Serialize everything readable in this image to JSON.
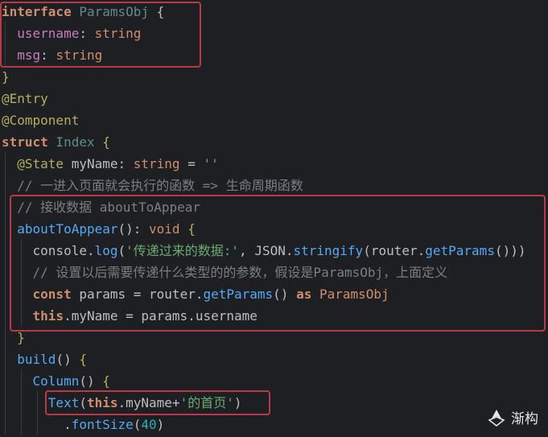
{
  "code": {
    "lines": [
      [
        {
          "t": "interface",
          "c": "kw"
        },
        {
          "t": " ParamsObj ",
          "c": "cls"
        },
        {
          "t": "{",
          "c": "plain"
        }
      ],
      [
        {
          "t": "  username",
          "c": "fld"
        },
        {
          "t": ": ",
          "c": "plain"
        },
        {
          "t": "string",
          "c": "type"
        }
      ],
      [
        {
          "t": "  msg",
          "c": "fld"
        },
        {
          "t": ": ",
          "c": "plain"
        },
        {
          "t": "string",
          "c": "type"
        }
      ],
      [
        {
          "t": "}",
          "c": "dec"
        }
      ],
      [
        {
          "t": "@Entry",
          "c": "dec"
        }
      ],
      [
        {
          "t": "@Component",
          "c": "dec"
        }
      ],
      [
        {
          "t": "struct",
          "c": "kw"
        },
        {
          "t": " Index ",
          "c": "cls"
        },
        {
          "t": "{",
          "c": "dec"
        }
      ],
      [
        {
          "t": "  @State",
          "c": "dec"
        },
        {
          "t": " myName",
          "c": "plain"
        },
        {
          "t": ": ",
          "c": "plain"
        },
        {
          "t": "string",
          "c": "type"
        },
        {
          "t": " = ",
          "c": "plain"
        },
        {
          "t": "''",
          "c": "str"
        }
      ],
      [
        {
          "t": "  // 一进入页面就会执行的函数 => 生命周期函数",
          "c": "cmt"
        }
      ],
      [
        {
          "t": "  // 接收数据 aboutToAppear",
          "c": "cmt"
        }
      ],
      [
        {
          "t": "  aboutToAppear",
          "c": "fn"
        },
        {
          "t": "(): ",
          "c": "plain"
        },
        {
          "t": "void",
          "c": "type"
        },
        {
          "t": " {",
          "c": "dec"
        }
      ],
      [
        {
          "t": "    console.",
          "c": "plain"
        },
        {
          "t": "log",
          "c": "fn"
        },
        {
          "t": "(",
          "c": "plain"
        },
        {
          "t": "'传递过来的数据:'",
          "c": "str"
        },
        {
          "t": ", JSON.",
          "c": "plain"
        },
        {
          "t": "stringify",
          "c": "fn"
        },
        {
          "t": "(router.",
          "c": "plain"
        },
        {
          "t": "getParams",
          "c": "fn"
        },
        {
          "t": "()))",
          "c": "plain"
        }
      ],
      [
        {
          "t": "    // 设置以后需要传递什么类型的的参数，假设是ParamsObj，上面定义",
          "c": "cmt"
        }
      ],
      [
        {
          "t": "    const",
          "c": "kw"
        },
        {
          "t": " params = router.",
          "c": "plain"
        },
        {
          "t": "getParams",
          "c": "fn"
        },
        {
          "t": "() ",
          "c": "plain"
        },
        {
          "t": "as",
          "c": "kw"
        },
        {
          "t": " ParamsObj",
          "c": "type"
        }
      ],
      [
        {
          "t": "    this",
          "c": "kw"
        },
        {
          "t": ".myName = params.username",
          "c": "plain"
        }
      ],
      [
        {
          "t": "  }",
          "c": "dec"
        }
      ],
      [
        {
          "t": "  build",
          "c": "fn"
        },
        {
          "t": "() ",
          "c": "plain"
        },
        {
          "t": "{",
          "c": "dec"
        }
      ],
      [
        {
          "t": "    Column",
          "c": "fn"
        },
        {
          "t": "() ",
          "c": "plain"
        },
        {
          "t": "{",
          "c": "dec"
        }
      ],
      [
        {
          "t": "      Text",
          "c": "fn"
        },
        {
          "t": "(",
          "c": "plain"
        },
        {
          "t": "this",
          "c": "kw"
        },
        {
          "t": ".myName+",
          "c": "plain"
        },
        {
          "t": "'的首页'",
          "c": "str"
        },
        {
          "t": ")",
          "c": "plain"
        }
      ],
      [
        {
          "t": "        .",
          "c": "plain"
        },
        {
          "t": "fontSize",
          "c": "fn"
        },
        {
          "t": "(",
          "c": "plain"
        },
        {
          "t": "40",
          "c": "num"
        },
        {
          "t": ")",
          "c": "plain"
        }
      ]
    ]
  },
  "watermark": {
    "text": "渐构",
    "icon": "leaf-logo-icon"
  }
}
